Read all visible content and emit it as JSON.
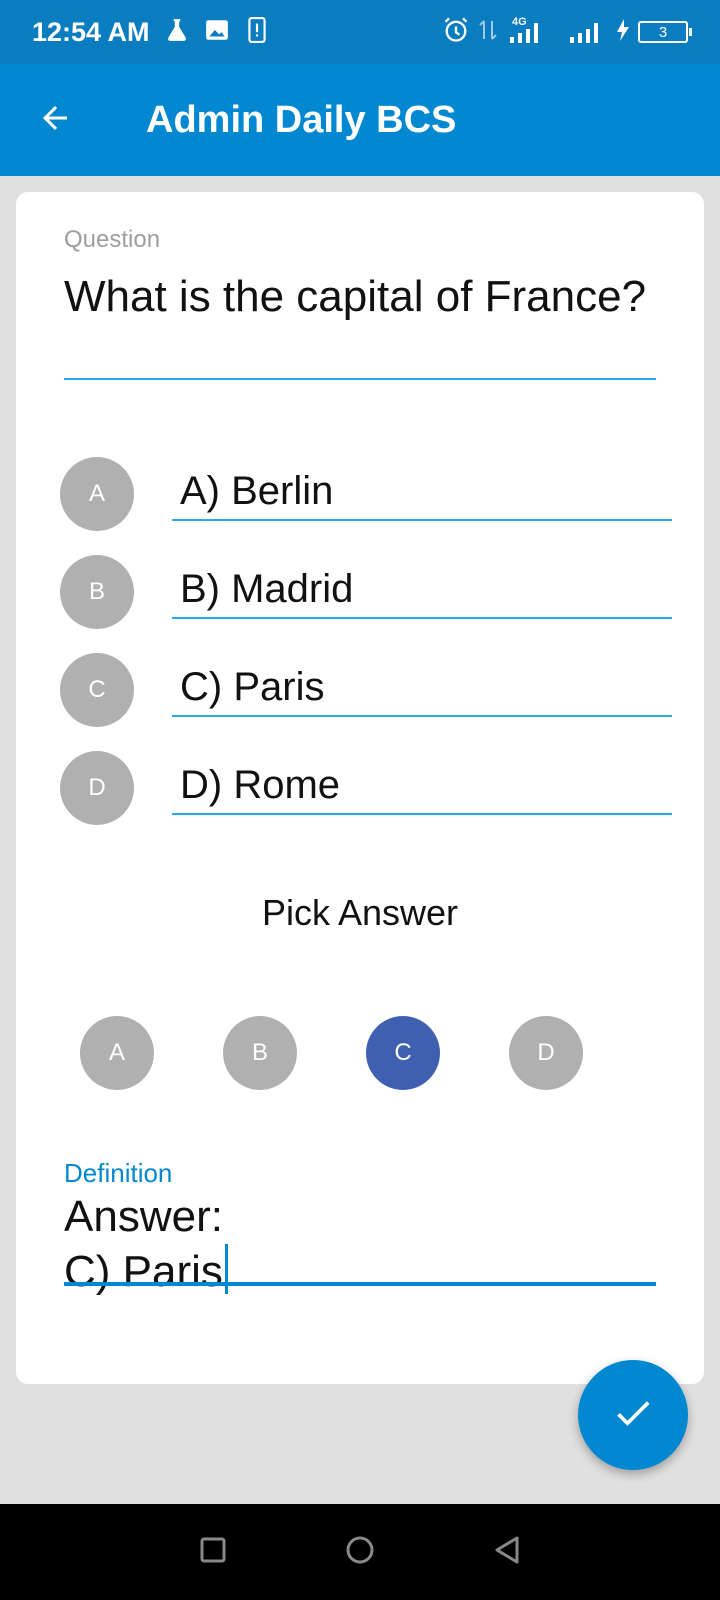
{
  "status_bar": {
    "time": "12:54 AM",
    "battery_level": "3",
    "network": "4G"
  },
  "app_bar": {
    "title": "Admin Daily BCS"
  },
  "question": {
    "label": "Question",
    "text": "What is the capital of France?"
  },
  "options": [
    {
      "letter": "A",
      "text": "A) Berlin"
    },
    {
      "letter": "B",
      "text": "B) Madrid"
    },
    {
      "letter": "C",
      "text": "C) Paris"
    },
    {
      "letter": "D",
      "text": "D) Rome"
    }
  ],
  "pick": {
    "label": "Pick Answer",
    "choices": [
      "A",
      "B",
      "C",
      "D"
    ],
    "selected": "C"
  },
  "definition": {
    "label": "Definition",
    "text": "Answer:\nC) Paris"
  },
  "colors": {
    "primary": "#0288d1",
    "status": "#0a7cc0",
    "selected": "#3f60b0",
    "inactive": "#b0b0b0"
  }
}
